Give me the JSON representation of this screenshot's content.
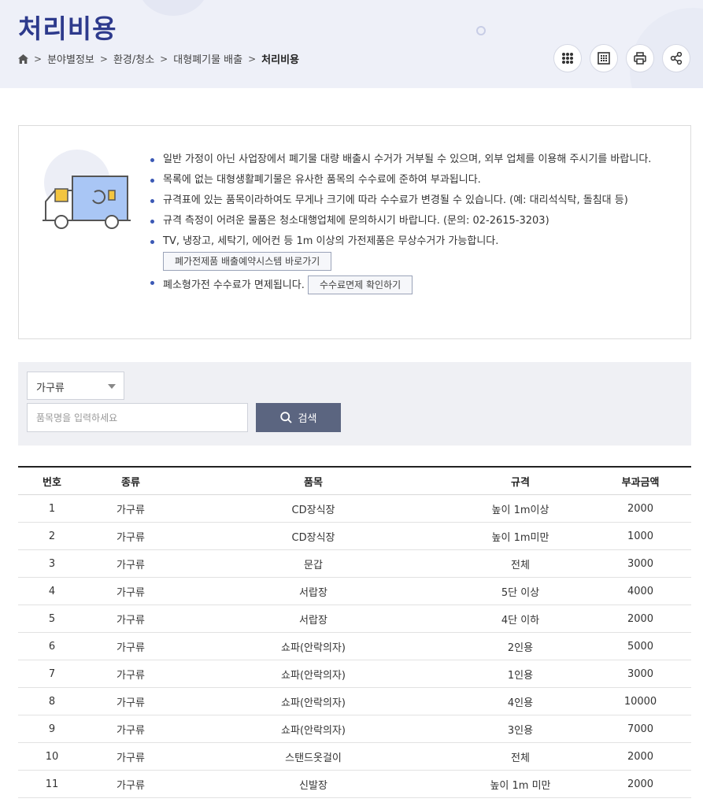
{
  "header": {
    "title": "처리비용",
    "breadcrumb": [
      "분야별정보",
      "환경/청소",
      "대형폐기물 배출"
    ],
    "breadcrumb_current": "처리비용",
    "tools": [
      {
        "name": "menu-dots-icon"
      },
      {
        "name": "qr-code-icon"
      },
      {
        "name": "print-icon"
      },
      {
        "name": "share-icon"
      }
    ]
  },
  "notice": {
    "items": [
      "일반 가정이 아닌 사업장에서 폐기물 대량 배출시 수거가 거부될 수 있으며, 외부 업체를 이용해 주시기를 바랍니다.",
      "목록에 없는 대형생활폐기물은 유사한 품목의 수수료에 준하여 부과됩니다.",
      "규격표에 있는 품목이라하여도 무게나 크기에 따라 수수료가 변경될 수 있습니다. (예: 대리석식탁, 돌침대 등)",
      "규격 측정이 어려운 물품은 청소대행업체에 문의하시기 바랍니다. (문의: 02-2615-3203)",
      "TV, 냉장고, 세탁기, 에어컨 등 1m 이상의 가전제품은 무상수거가 가능합니다.",
      "폐소형가전 수수료가 면제됩니다."
    ],
    "appliance_link": "폐가전제품 배출예약시스템 바로가기",
    "exempt_link": "수수료면제 확인하기"
  },
  "search": {
    "category_selected": "가구류",
    "placeholder": "품목명을 입력하세요",
    "button_label": "검색"
  },
  "table": {
    "headers": [
      "번호",
      "종류",
      "품목",
      "규격",
      "부과금액"
    ],
    "rows": [
      [
        "1",
        "가구류",
        "CD장식장",
        "높이 1m이상",
        "2000"
      ],
      [
        "2",
        "가구류",
        "CD장식장",
        "높이 1m미만",
        "1000"
      ],
      [
        "3",
        "가구류",
        "문갑",
        "전체",
        "3000"
      ],
      [
        "4",
        "가구류",
        "서랍장",
        "5단 이상",
        "4000"
      ],
      [
        "5",
        "가구류",
        "서랍장",
        "4단 이하",
        "2000"
      ],
      [
        "6",
        "가구류",
        "쇼파(안락의자)",
        "2인용",
        "5000"
      ],
      [
        "7",
        "가구류",
        "쇼파(안락의자)",
        "1인용",
        "3000"
      ],
      [
        "8",
        "가구류",
        "쇼파(안락의자)",
        "4인용",
        "10000"
      ],
      [
        "9",
        "가구류",
        "쇼파(안락의자)",
        "3인용",
        "7000"
      ],
      [
        "10",
        "가구류",
        "스탠드옷걸이",
        "전체",
        "2000"
      ],
      [
        "11",
        "가구류",
        "신발장",
        "높이 1m 미만",
        "2000"
      ]
    ]
  },
  "colors": {
    "title": "#2d3a8c",
    "header_bg": "#eef0f8",
    "search_button": "#5b6580",
    "bullet": "#3b59b5"
  }
}
